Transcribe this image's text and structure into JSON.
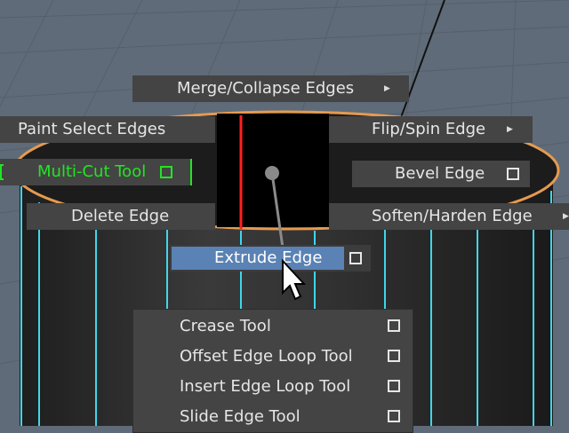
{
  "colors": {
    "grid_background": "#5f6b78",
    "menu_background": "#444444",
    "menu_text": "#e6e6e6",
    "highlight": "#5a82b4",
    "multicut_green": "#22e522",
    "selection_orange": "#e69a50",
    "edge_cyan": "#3fd6ea",
    "red_line": "#ff2020"
  },
  "marking_menu": {
    "north": {
      "label": "Merge/Collapse Edges",
      "submenu_icon": "triangle-right-icon"
    },
    "northwest": {
      "label": "Paint Select Edges"
    },
    "northeast": {
      "label": "Flip/Spin Edge",
      "submenu_icon": "triangle-right-icon"
    },
    "west": {
      "label": "Multi-Cut Tool",
      "option_icon": "option-box-icon"
    },
    "east": {
      "label": "Bevel Edge",
      "option_icon": "option-box-icon"
    },
    "southwest": {
      "label": "Delete Edge"
    },
    "southeast": {
      "label": "Soften/Harden Edge",
      "submenu_icon": "triangle-right-icon"
    },
    "south": {
      "label": "Extrude Edge",
      "option_icon": "option-box-icon",
      "highlighted": true
    }
  },
  "popup_menu": {
    "items": [
      {
        "label": "Crease Tool"
      },
      {
        "label": "Offset Edge Loop Tool"
      },
      {
        "label": "Insert Edge Loop Tool"
      },
      {
        "label": "Slide Edge Tool"
      }
    ]
  }
}
